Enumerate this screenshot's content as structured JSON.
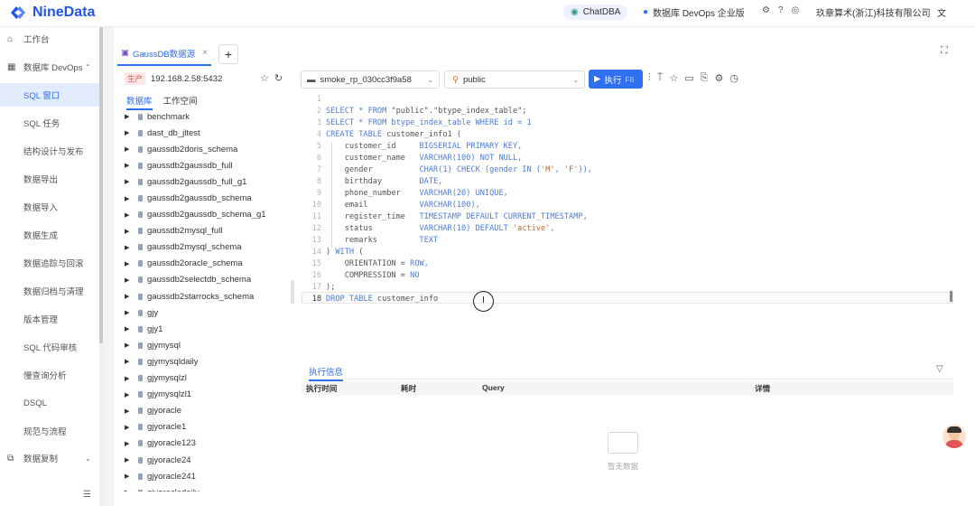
{
  "brand": {
    "name": "NineData",
    "color": "#2355e8"
  },
  "topbar": {
    "chatdba": "ChatDBA",
    "edition": "数据库 DevOps 企业版",
    "company": "玖章算术(浙江)科技有限公司",
    "icons": [
      "chatdba-icon",
      "devops-icon",
      "settings-icon",
      "help-icon",
      "github-icon",
      "user-icon",
      "language-icon"
    ]
  },
  "sidebar": {
    "workbench": "工作台",
    "group": "数据库 DevOps",
    "items": [
      "SQL 窗口",
      "SQL 任务",
      "结构设计与发布",
      "数据导出",
      "数据导入",
      "数据生成",
      "数据追踪与回滚",
      "数据归档与清理",
      "版本管理",
      "SQL 代码审核",
      "慢查询分析",
      "DSQL",
      "规范与流程"
    ],
    "replication": "数据复制"
  },
  "tabs": {
    "active": "GaussDB数据源",
    "add": "+"
  },
  "connection": {
    "env": "生产",
    "host": "192.168.2.58:5432"
  },
  "selectors": {
    "database": "smoke_rp_030cc3f9a58",
    "schema": "public"
  },
  "run": {
    "label": "执行",
    "shortcut": "F8"
  },
  "tree": {
    "tabs": [
      "数据库",
      "工作空间"
    ],
    "items": [
      "benchmark",
      "dast_db_jltest",
      "gaussdb2doris_schema",
      "gaussdb2gaussdb_full",
      "gaussdb2gaussdb_full_g1",
      "gaussdb2gaussdb_schema",
      "gaussdb2gaussdb_schema_g1",
      "gaussdb2mysql_full",
      "gaussdb2mysql_schema",
      "gaussdb2oracle_schema",
      "gaussdb2selectdb_schema",
      "gaussdb2starrocks_schema",
      "gjy",
      "gjy1",
      "gjymysql",
      "gjymysqldaily",
      "gjymysqlzl",
      "gjymysqlzl1",
      "gjyoracle",
      "gjyoracle1",
      "gjyoracle123",
      "gjyoracle24",
      "gjyoracle241",
      "gjyoracledaily"
    ]
  },
  "editor": {
    "lines": [
      [],
      [
        {
          "t": "SELECT * FROM ",
          "c": "kw"
        },
        {
          "t": "\"public\".\"btype_index_table\";",
          "c": ""
        }
      ],
      [
        {
          "t": "SELECT * FROM btype_index_table WHERE id = 1",
          "c": "kw"
        }
      ],
      [
        {
          "t": "CREATE TABLE ",
          "c": "kw"
        },
        {
          "t": "customer_info1 (",
          "c": ""
        }
      ],
      [
        {
          "t": "    customer_id     ",
          "c": ""
        },
        {
          "t": "BIGSERIAL PRIMARY KEY,",
          "c": "kw"
        }
      ],
      [
        {
          "t": "    customer_name   ",
          "c": ""
        },
        {
          "t": "VARCHAR(100) NOT NULL,",
          "c": "kw"
        }
      ],
      [
        {
          "t": "    gender          ",
          "c": ""
        },
        {
          "t": "CHAR(1) CHECK (gender IN (",
          "c": "kw"
        },
        {
          "t": "'M'",
          "c": "st"
        },
        {
          "t": ", ",
          "c": "kw"
        },
        {
          "t": "'F'",
          "c": "st"
        },
        {
          "t": ")),",
          "c": "kw"
        }
      ],
      [
        {
          "t": "    birthday        ",
          "c": ""
        },
        {
          "t": "DATE,",
          "c": "kw"
        }
      ],
      [
        {
          "t": "    phone_number    ",
          "c": ""
        },
        {
          "t": "VARCHAR(20) UNIQUE,",
          "c": "kw"
        }
      ],
      [
        {
          "t": "    email           ",
          "c": ""
        },
        {
          "t": "VARCHAR(100),",
          "c": "kw"
        }
      ],
      [
        {
          "t": "    register_time   ",
          "c": ""
        },
        {
          "t": "TIMESTAMP DEFAULT CURRENT_TIMESTAMP,",
          "c": "kw"
        }
      ],
      [
        {
          "t": "    status          ",
          "c": ""
        },
        {
          "t": "VARCHAR(10) DEFAULT ",
          "c": "kw"
        },
        {
          "t": "'active'",
          "c": "st"
        },
        {
          "t": ",",
          "c": "kw"
        }
      ],
      [
        {
          "t": "    remarks         ",
          "c": ""
        },
        {
          "t": "TEXT",
          "c": "kw"
        }
      ],
      [
        {
          "t": ") ",
          "c": ""
        },
        {
          "t": "WITH",
          "c": "kw"
        },
        {
          "t": " (",
          "c": ""
        }
      ],
      [
        {
          "t": "    ORIENTATION = ",
          "c": ""
        },
        {
          "t": "ROW,",
          "c": "kw"
        }
      ],
      [
        {
          "t": "    COMPRESSION = ",
          "c": ""
        },
        {
          "t": "NO",
          "c": "kw"
        }
      ],
      [
        {
          "t": ");",
          "c": ""
        }
      ],
      [
        {
          "t": "DROP TABLE ",
          "c": "kw"
        },
        {
          "t": "customer_info",
          "c": ""
        }
      ]
    ],
    "cursor_symbol": "I"
  },
  "results": {
    "tab": "执行信息",
    "columns": [
      "执行时间",
      "耗时",
      "Query",
      "详情"
    ],
    "empty": "暂无数据"
  },
  "colors": {
    "accent": "#2f6ff0",
    "env": "#e05454"
  }
}
